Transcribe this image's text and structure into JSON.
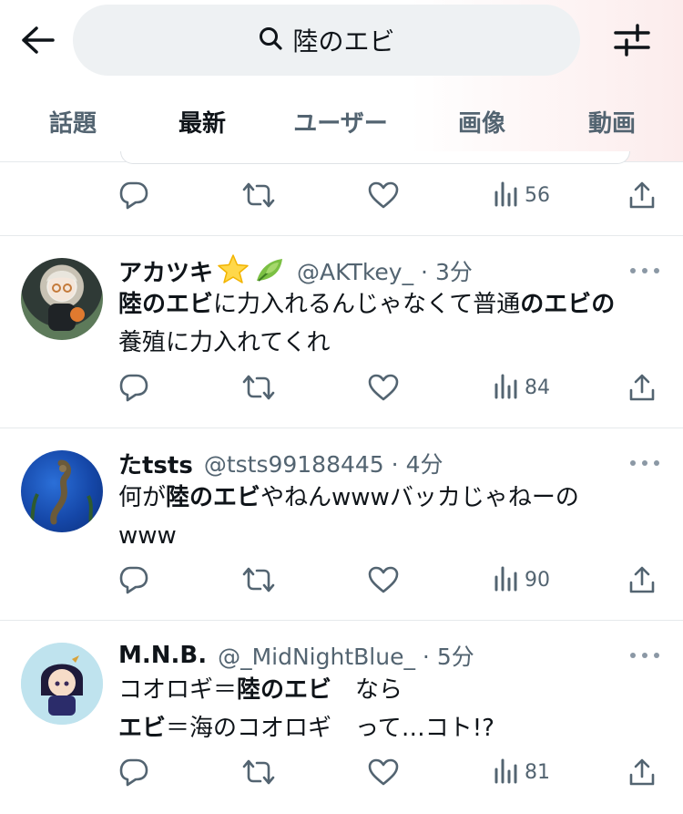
{
  "search": {
    "query": "陸のエビ"
  },
  "tabs": [
    {
      "label": "話題"
    },
    {
      "label": "最新"
    },
    {
      "label": "ユーザー"
    },
    {
      "label": "画像"
    },
    {
      "label": "動画"
    }
  ],
  "active_tab": "最新",
  "top_actions": {
    "views": "56"
  },
  "tweets": [
    {
      "name": "アカツキ",
      "handle": "@AKTkey_",
      "time": "3分",
      "text": [
        [
          {
            "t": "陸のエビ",
            "b": true
          },
          {
            "t": "に力入れるんじゃなくて普通",
            "b": false
          },
          {
            "t": "のエビの",
            "b": true
          }
        ],
        [
          {
            "t": "養殖に力入れてくれ",
            "b": false
          }
        ]
      ],
      "views": "84"
    },
    {
      "name": "たtsts",
      "handle": "@tsts99188445",
      "time": "4分",
      "text": [
        [
          {
            "t": "何が",
            "b": false
          },
          {
            "t": "陸のエビ",
            "b": true
          },
          {
            "t": "やねんwwwバッカじゃねーの",
            "b": false
          }
        ],
        [
          {
            "t": "www",
            "b": false
          }
        ]
      ],
      "views": "90"
    },
    {
      "name": "M.N.B.",
      "handle": "@_MidNightBlue_",
      "time": "5分",
      "text": [
        [
          {
            "t": "コオロギ＝",
            "b": false
          },
          {
            "t": "陸のエビ",
            "b": true
          },
          {
            "t": "　なら",
            "b": false
          }
        ],
        [
          {
            "t": "エビ",
            "b": true
          },
          {
            "t": "＝海のコオロギ　って…コト!?",
            "b": false
          }
        ]
      ],
      "views": "81"
    }
  ],
  "colors": {
    "accent": "#1d9bf0",
    "secondary_text": "#536471",
    "primary_text": "#0f1419",
    "search_bg": "#eef1f3"
  },
  "icons": [
    "back-arrow-icon",
    "search-icon",
    "filter-icon",
    "reply-icon",
    "retweet-icon",
    "like-icon",
    "views-icon",
    "share-icon",
    "more-icon",
    "star-emoji-icon",
    "leaf-emoji-icon"
  ]
}
